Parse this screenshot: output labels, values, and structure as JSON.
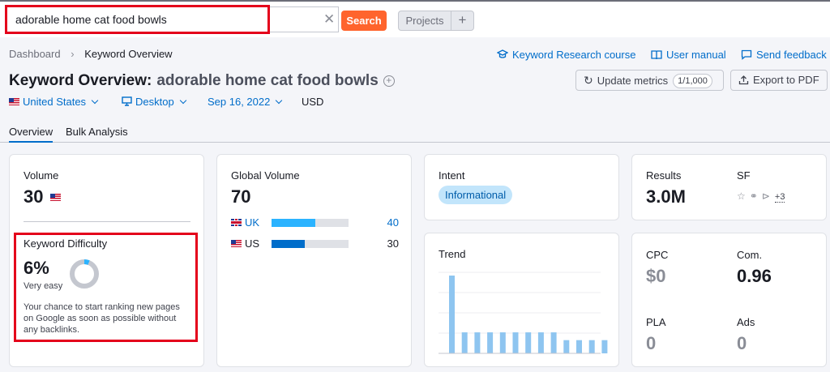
{
  "search": {
    "query": "adorable home cat food bowls",
    "button_label": "Search"
  },
  "header": {
    "projects_label": "Projects",
    "add_label": "+"
  },
  "breadcrumb": {
    "root": "Dashboard",
    "current": "Keyword Overview"
  },
  "links": {
    "course": "Keyword Research course",
    "manual": "User manual",
    "feedback": "Send feedback"
  },
  "title": {
    "prefix": "Keyword Overview:",
    "keyword": "adorable home cat food bowls"
  },
  "actions": {
    "update_label": "Update metrics",
    "limit": "1/1,000",
    "export_label": "Export to PDF"
  },
  "filters": {
    "country": "United States",
    "device": "Desktop",
    "date": "Sep 16, 2022",
    "currency": "USD"
  },
  "tabs": [
    {
      "label": "Overview"
    },
    {
      "label": "Bulk Analysis"
    }
  ],
  "volume": {
    "label": "Volume",
    "value": "30"
  },
  "kd": {
    "label": "Keyword Difficulty",
    "value": "6%",
    "percent": 6,
    "level": "Very easy",
    "description_lines": [
      "Your chance to start ranking new pages",
      "on Google as soon as possible without",
      "any backlinks."
    ]
  },
  "global_volume": {
    "label": "Global Volume",
    "value": "70",
    "rows": [
      {
        "country": "UK",
        "value": "40",
        "fraction": 0.57,
        "color": "#2bb3ff"
      },
      {
        "country": "US",
        "value": "30",
        "fraction": 0.43,
        "color": "#006dca"
      }
    ]
  },
  "intent": {
    "label": "Intent",
    "value": "Informational"
  },
  "results": {
    "label": "Results",
    "value": "3.0M",
    "sf_label": "SF",
    "sf_more": "+3"
  },
  "trend": {
    "label": "Trend",
    "values": [
      1.0,
      0.27,
      0.27,
      0.27,
      0.27,
      0.27,
      0.27,
      0.27,
      0.27,
      0.17,
      0.17,
      0.17,
      0.17
    ],
    "color": "#8ec5f0"
  },
  "metrics": {
    "cpc_label": "CPC",
    "cpc_value": "$0",
    "com_label": "Com.",
    "com_value": "0.96",
    "pla_label": "PLA",
    "pla_value": "0",
    "ads_label": "Ads",
    "ads_value": "0"
  }
}
